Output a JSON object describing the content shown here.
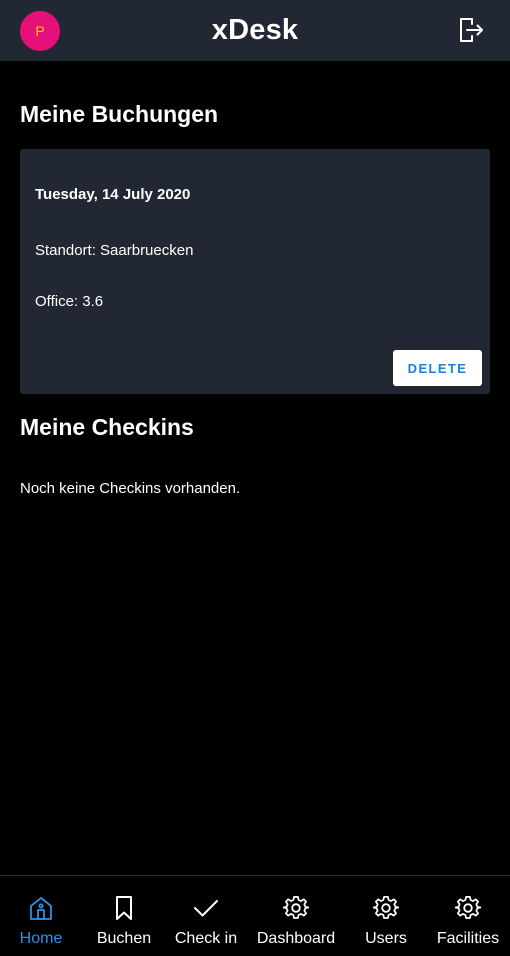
{
  "header": {
    "avatar_initial": "P",
    "title": "xDesk",
    "logout_icon": "logout-icon"
  },
  "bookings": {
    "title": "Meine Buchungen",
    "items": [
      {
        "date": "Tuesday, 14 July 2020",
        "location": "Standort: Saarbruecken",
        "office": "Office: 3.6",
        "delete_label": "DELETE"
      }
    ]
  },
  "checkins": {
    "title": "Meine Checkins",
    "empty_text": "Noch keine Checkins vorhanden."
  },
  "nav": {
    "items": [
      {
        "label": "Home",
        "icon": "home-icon",
        "active": true
      },
      {
        "label": "Buchen",
        "icon": "bookmark-icon",
        "active": false
      },
      {
        "label": "Check in",
        "icon": "check-icon",
        "active": false
      },
      {
        "label": "Dashboard",
        "icon": "gear-icon",
        "active": false
      },
      {
        "label": "Users",
        "icon": "gear-icon",
        "active": false
      },
      {
        "label": "Facilities",
        "icon": "gear-icon",
        "active": false
      }
    ]
  },
  "colors": {
    "header_bg": "#222833",
    "card_bg": "#222833",
    "avatar_bg": "#e6107a",
    "avatar_text": "#f2d200",
    "accent": "#2f8fe0",
    "delete_text": "#1f7fd1"
  }
}
